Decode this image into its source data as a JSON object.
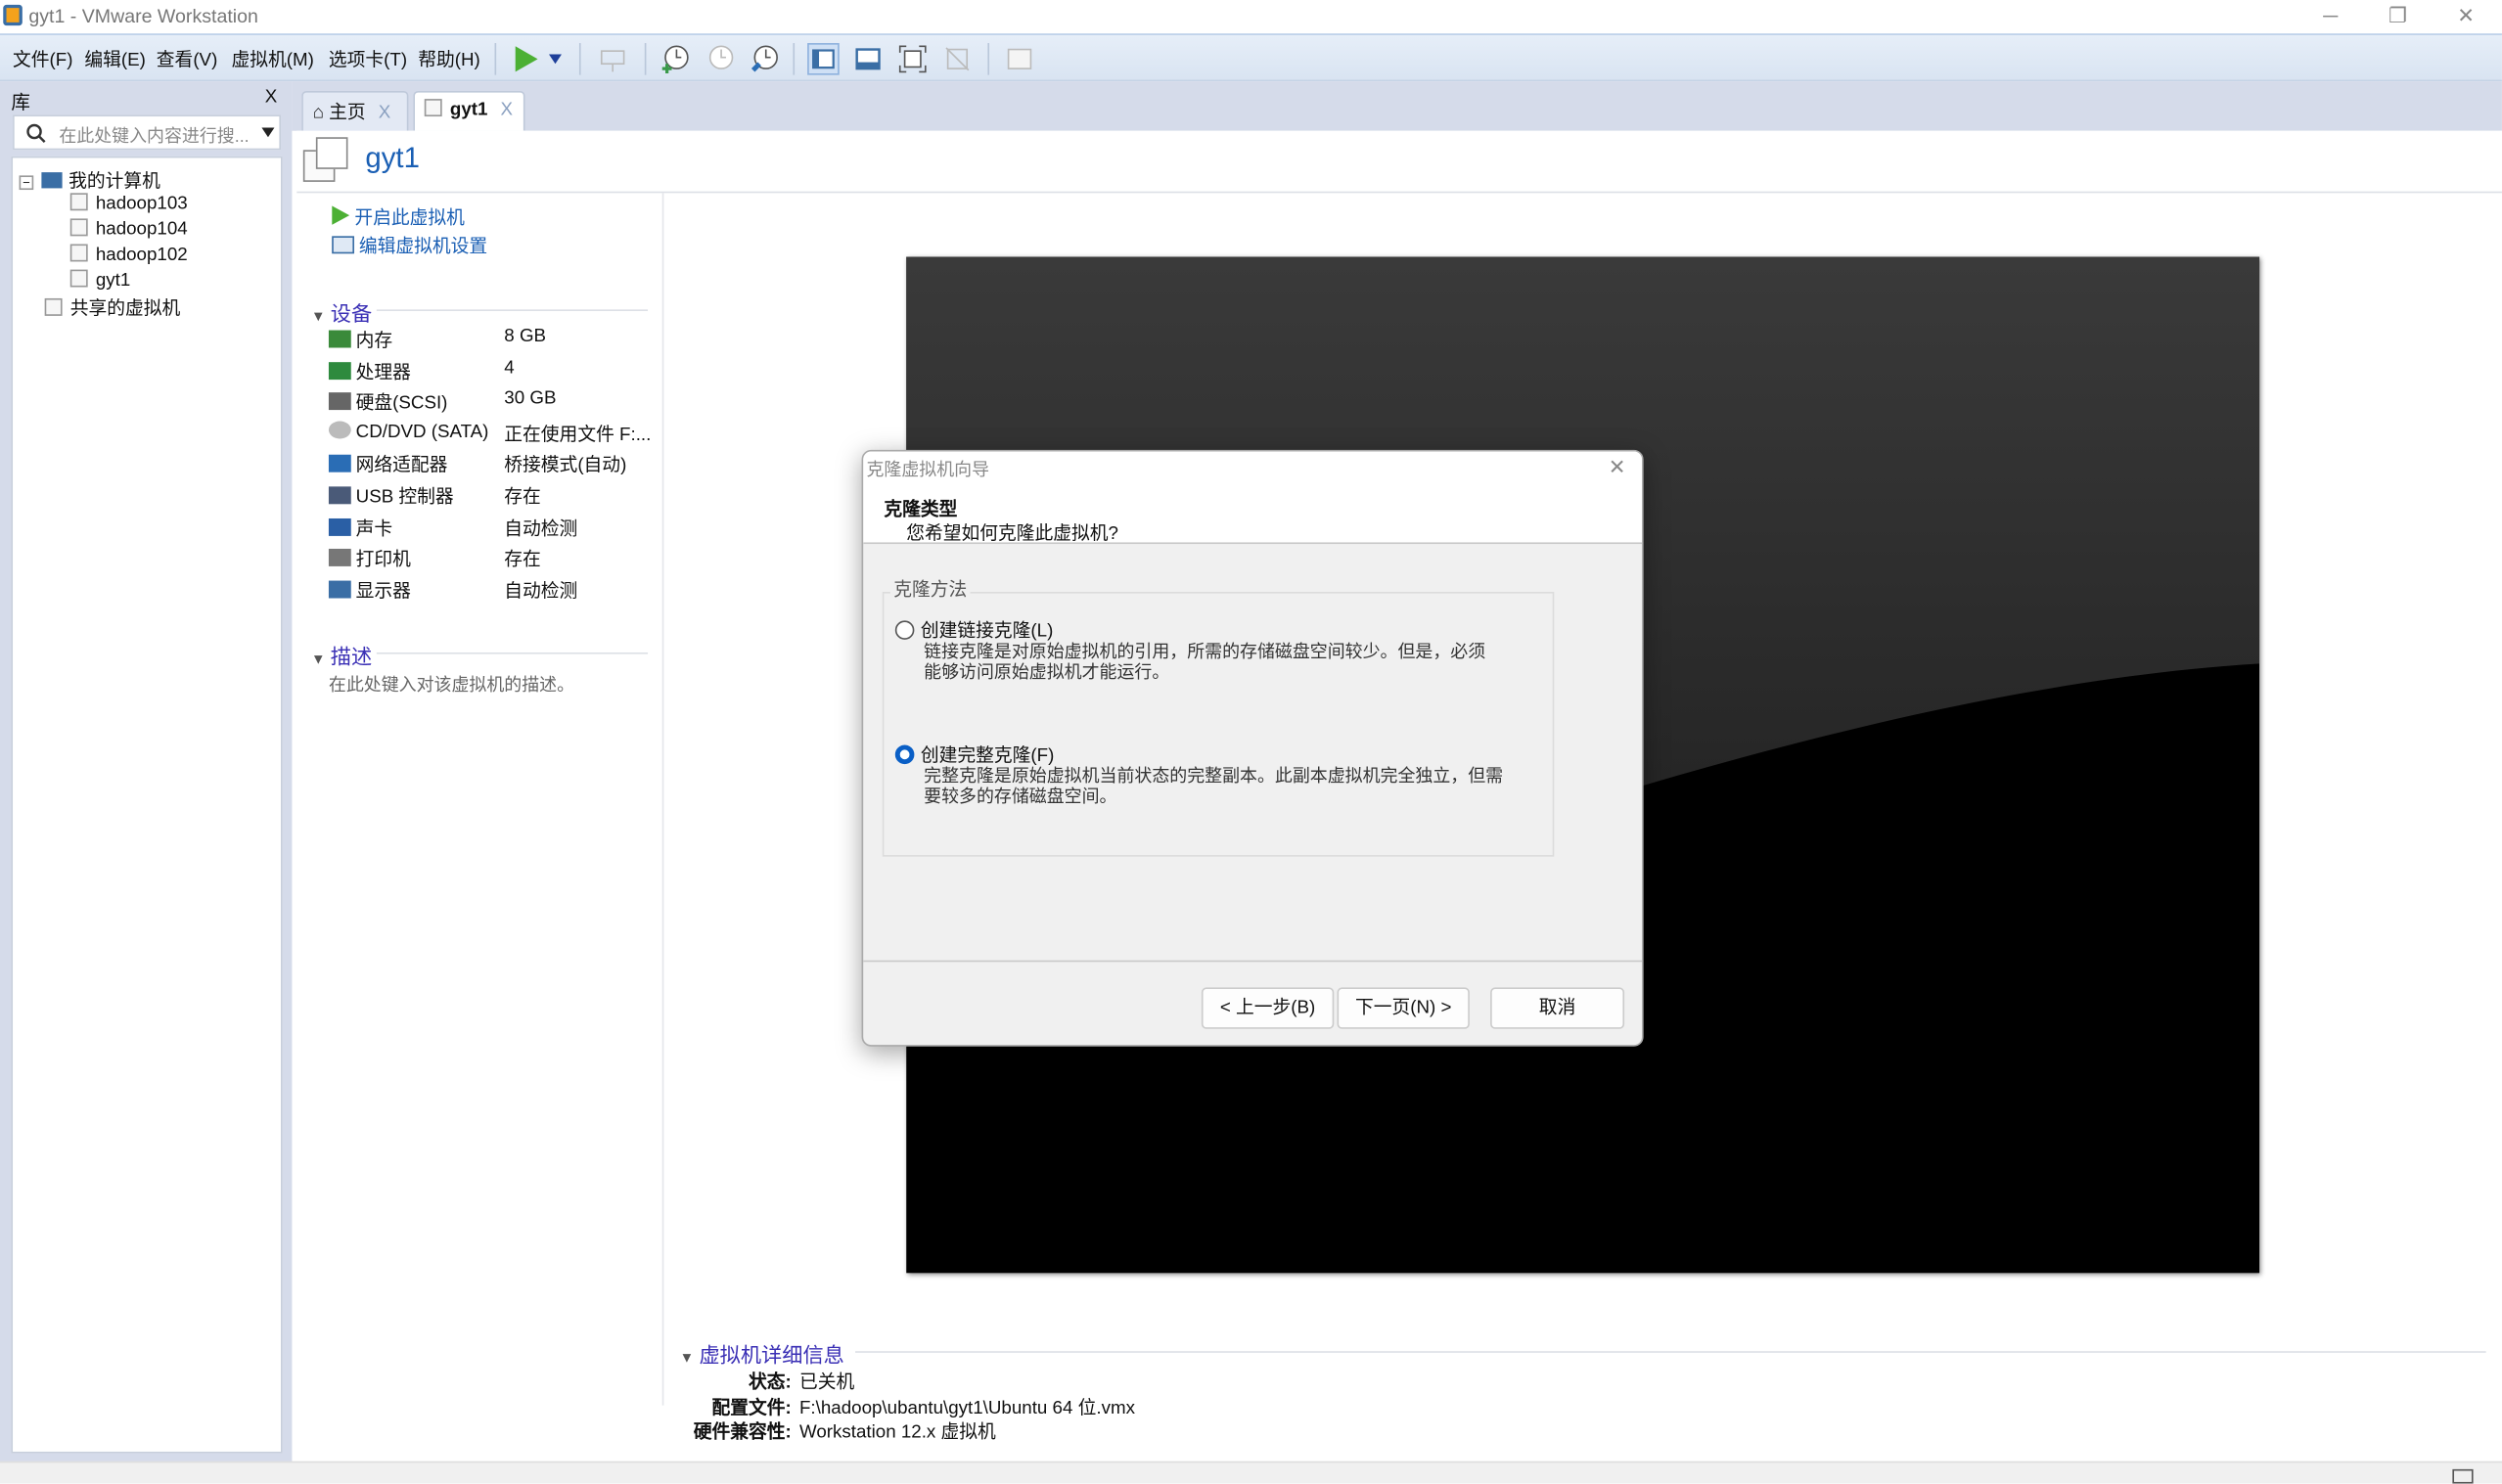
{
  "window": {
    "title": "gyt1 - VMware Workstation",
    "minimize": "─",
    "restore": "❐",
    "close": "✕"
  },
  "menu": [
    "文件(F)",
    "编辑(E)",
    "查看(V)",
    "虚拟机(M)",
    "选项卡(T)",
    "帮助(H)"
  ],
  "toolbar_icons": [
    "power-on-icon",
    "dropdown-icon",
    "send-keys-icon",
    "snapshot-take-icon",
    "snapshot-revert-icon",
    "snapshot-manager-icon",
    "library-view-icon",
    "thumbnail-view-icon",
    "fullscreen-icon",
    "unity-icon",
    "console-view-icon"
  ],
  "library": {
    "title": "库",
    "close": "X",
    "search_placeholder": "在此处键入内容进行搜...",
    "tree": {
      "root": "我的计算机",
      "vms": [
        "hadoop103",
        "hadoop104",
        "hadoop102",
        "gyt1"
      ],
      "shared": "共享的虚拟机"
    }
  },
  "tabs": [
    {
      "label": "主页",
      "close": "X"
    },
    {
      "label": "gyt1",
      "close": "X"
    }
  ],
  "vm": {
    "name": "gyt1",
    "actions": {
      "power_on": "开启此虚拟机",
      "edit_settings": "编辑虚拟机设置"
    },
    "devices_title": "设备",
    "devices": [
      {
        "name": "内存",
        "value": "8 GB"
      },
      {
        "name": "处理器",
        "value": "4"
      },
      {
        "name": "硬盘(SCSI)",
        "value": "30 GB"
      },
      {
        "name": "CD/DVD (SATA)",
        "value": "正在使用文件 F:..."
      },
      {
        "name": "网络适配器",
        "value": "桥接模式(自动)"
      },
      {
        "name": "USB 控制器",
        "value": "存在"
      },
      {
        "name": "声卡",
        "value": "自动检测"
      },
      {
        "name": "打印机",
        "value": "存在"
      },
      {
        "name": "显示器",
        "value": "自动检测"
      }
    ],
    "description_title": "描述",
    "description_placeholder": "在此处键入对该虚拟机的描述。",
    "details_title": "虚拟机详细信息",
    "details": {
      "state_label": "状态:",
      "state": "已关机",
      "config_label": "配置文件:",
      "config": "F:\\hadoop\\ubantu\\gyt1\\Ubuntu 64 位.vmx",
      "compat_label": "硬件兼容性:",
      "compat": "Workstation 12.x 虚拟机"
    }
  },
  "dialog": {
    "title": "克隆虚拟机向导",
    "close": "✕",
    "heading": "克隆类型",
    "subheading": "您希望如何克隆此虚拟机?",
    "group_label": "克隆方法",
    "options": [
      {
        "label": "创建链接克隆(L)",
        "desc1": "链接克隆是对原始虚拟机的引用，所需的存储磁盘空间较少。但是，必须",
        "desc2": "能够访问原始虚拟机才能运行。",
        "selected": false
      },
      {
        "label": "创建完整克隆(F)",
        "desc1": "完整克隆是原始虚拟机当前状态的完整副本。此副本虚拟机完全独立，但需",
        "desc2": "要较多的存储磁盘空间。",
        "selected": true
      }
    ],
    "buttons": {
      "back": "< 上一步(B)",
      "next": "下一页(N) >",
      "cancel": "取消"
    }
  }
}
